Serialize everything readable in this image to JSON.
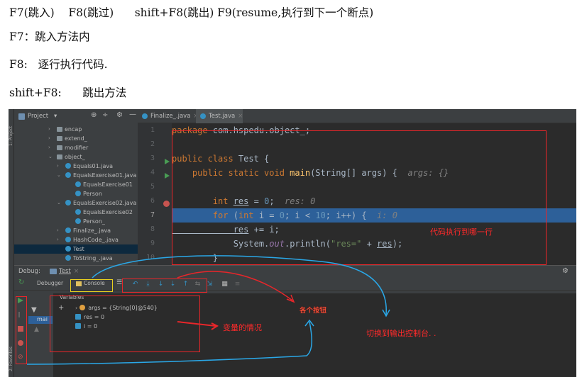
{
  "doc": {
    "line1": "F7(跳入)    F8(跳过)      shift+F8(跳出) F9(resume,执行到下一个断点)",
    "line2": "F7：跳入方法内",
    "line3": "F8:   逐行执行代码.",
    "line4": "shift+F8:      跳出方法"
  },
  "ide": {
    "side_label": "1: Project",
    "fav_label": "2: Favorites",
    "project": {
      "title": "Project",
      "tree": [
        {
          "label": "encap",
          "kind": "folder"
        },
        {
          "label": "extend_",
          "kind": "folder"
        },
        {
          "label": "modifier",
          "kind": "folder"
        },
        {
          "label": "object_",
          "kind": "folder"
        },
        {
          "label": "Equals01.java",
          "kind": "class"
        },
        {
          "label": "EqualsExercise01.java",
          "kind": "class"
        },
        {
          "label": "EqualsExercise01",
          "kind": "class"
        },
        {
          "label": "Person",
          "kind": "class"
        },
        {
          "label": "EqualsExercise02.java",
          "kind": "class"
        },
        {
          "label": "EqualsExercise02",
          "kind": "class"
        },
        {
          "label": "Person_",
          "kind": "class"
        },
        {
          "label": "Finalize_.java",
          "kind": "class"
        },
        {
          "label": "HashCode_.java",
          "kind": "class"
        },
        {
          "label": "Test",
          "kind": "class"
        },
        {
          "label": "ToString_.java",
          "kind": "class"
        }
      ]
    },
    "tabs": [
      "Finalize_.java",
      "Test.java"
    ],
    "line_numbers": [
      "1",
      "2",
      "3",
      "4",
      "5",
      "6",
      "7",
      "8",
      "9",
      "10"
    ],
    "code": {
      "l1_kw": "package",
      "l1_rest": " com.hspedu.object_;",
      "l3_kw": "public class",
      "l3_rest": " Test {",
      "l4_kw1": "    public static void ",
      "l4_fn": "main",
      "l4_rest": "(String[] args) {",
      "l4_hint": "  args: {}",
      "l6_kw": "        int ",
      "l6_var": "res",
      "l6_eq": " = ",
      "l6_num": "0",
      "l6_semi": ";",
      "l6_hint": "  res: 0",
      "l7_kw": "        for",
      "l7_a": " (",
      "l7_kw2": "int",
      "l7_b": " i = ",
      "l7_n1": "0",
      "l7_c": "; i < ",
      "l7_n2": "10",
      "l7_d": "; i++) {",
      "l7_hint": "  i: 0",
      "l8_var": "            res",
      "l8_rest": " += i;",
      "l9_a": "            System.",
      "l9_out": "out",
      "l9_b": ".println(",
      "l9_str": "\"res=\"",
      "l9_c": " + ",
      "l9_var": "res",
      "l9_d": ");",
      "l10": "        }"
    },
    "debug": {
      "title": "Debug:",
      "config": "Test",
      "tab_debugger": "Debugger",
      "tab_console": "Console",
      "frames_label": "mai",
      "vars_header": "Variables",
      "variables": [
        "args = {String[0]@540}",
        "res = 0",
        "i = 0"
      ]
    }
  },
  "annotations": {
    "code_line": "代码执行到哪一行",
    "vars_state": "变量的情况",
    "step_buttons": "各个按钮",
    "switch_console": "切换到输出控制台. ."
  },
  "colors": {
    "annotation_red": "#e8262a",
    "annotation_blue": "#2aa8e8",
    "highlight": "#2d6099"
  }
}
